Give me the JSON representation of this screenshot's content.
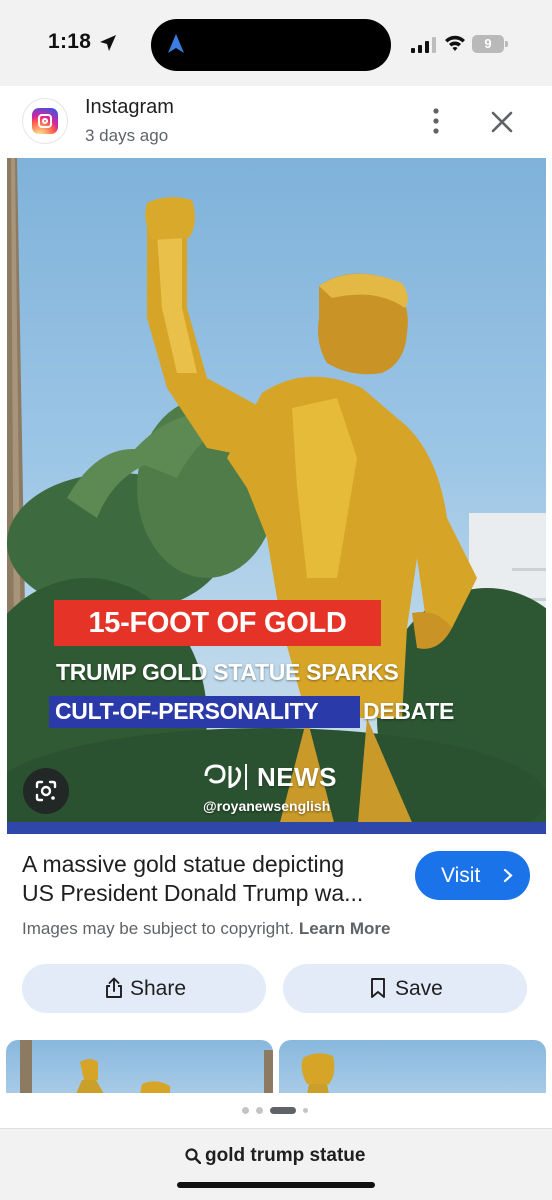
{
  "status_bar": {
    "time": "1:18",
    "battery": "9",
    "icons": [
      "location-arrow-icon",
      "signal-icon",
      "wifi-icon",
      "battery-icon"
    ]
  },
  "result": {
    "source": "Instagram",
    "posted": "3 days ago",
    "icons": [
      "instagram-logo",
      "more-vertical-icon",
      "close-icon"
    ]
  },
  "image": {
    "headline": "15-FOOT OF GOLD",
    "subline_1": "TRUMP GOLD STATUE SPARKS",
    "subline_2_highlight": "CULT-OF-PERSONALITY",
    "subline_2_rest": "DEBATE",
    "brand": "NEWS",
    "handle": "@royanewsenglish",
    "colors": {
      "headline_bg": "#e53427",
      "highlight_bg": "#2a3aa8"
    }
  },
  "caption": {
    "line1": "A massive gold statue depicting",
    "line2": "US President Donald Trump wa...",
    "visit_label": "Visit",
    "copyright_text": "Images may be subject to copyright.",
    "learn_more": "Learn More"
  },
  "actions": {
    "share_label": "Share",
    "save_label": "Save"
  },
  "pager": {
    "active_index": 2,
    "count": 4
  },
  "search": {
    "query": "gold trump statue"
  },
  "accent": "#1a73e8"
}
